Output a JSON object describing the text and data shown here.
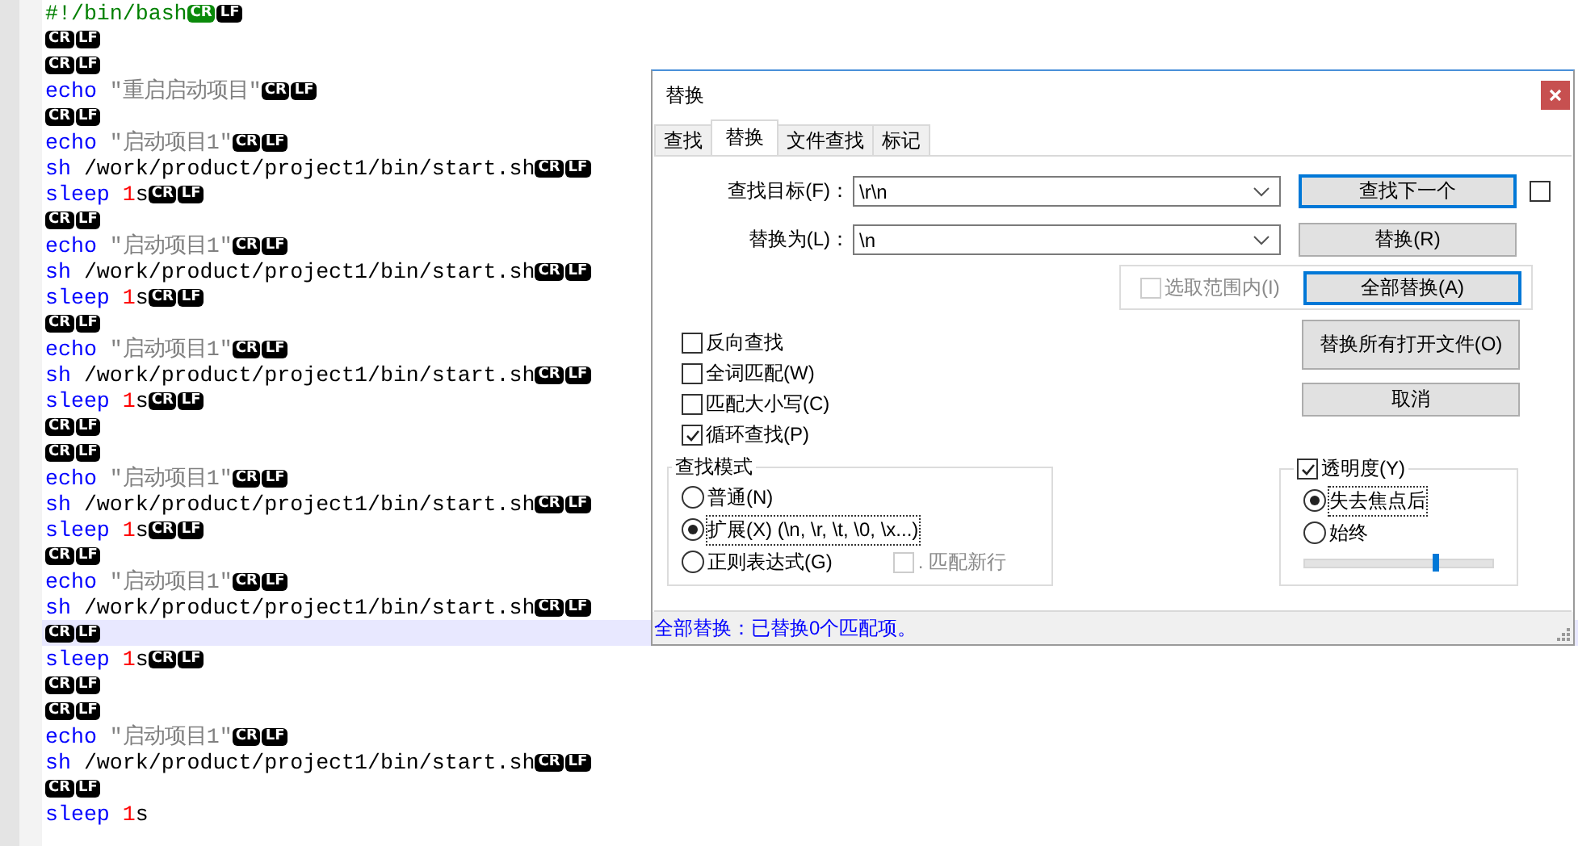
{
  "editor": {
    "lines": [
      {
        "tokens": [
          {
            "kind": "comment",
            "text": "#!/bin/bash"
          }
        ],
        "eol": [
          {
            "text": "CR",
            "highlighted": true
          },
          {
            "text": "LF",
            "highlighted": false
          }
        ],
        "current": false
      },
      {
        "eol": [
          {
            "text": "CR",
            "highlighted": false
          },
          {
            "text": "LF",
            "highlighted": false
          }
        ],
        "current": false
      },
      {
        "eol": [
          {
            "text": "CR",
            "highlighted": false
          },
          {
            "text": "LF",
            "highlighted": false
          }
        ],
        "current": false
      },
      {
        "tokens": [
          {
            "kind": "keyword",
            "text": "echo"
          },
          {
            "kind": "string",
            "text": " \"重启启动项目\""
          }
        ],
        "eol": [
          {
            "text": "CR",
            "highlighted": false
          },
          {
            "text": "LF",
            "highlighted": false
          }
        ],
        "current": false
      },
      {
        "eol": [
          {
            "text": "CR",
            "highlighted": false
          },
          {
            "text": "LF",
            "highlighted": false
          }
        ],
        "current": false
      },
      {
        "tokens": [
          {
            "kind": "keyword",
            "text": "echo"
          },
          {
            "kind": "string",
            "text": " \"启动项目1\""
          }
        ],
        "eol": [
          {
            "text": "CR",
            "highlighted": false
          },
          {
            "text": "LF",
            "highlighted": false
          }
        ],
        "current": false
      },
      {
        "tokens": [
          {
            "kind": "keyword",
            "text": "sh"
          },
          {
            "kind": "plain",
            "text": " /work/product/project1/bin/start.sh"
          }
        ],
        "eol": [
          {
            "text": "CR",
            "highlighted": false
          },
          {
            "text": "LF",
            "highlighted": false
          }
        ],
        "current": false
      },
      {
        "tokens": [
          {
            "kind": "keyword",
            "text": "sleep"
          },
          {
            "kind": "number",
            "text": " 1"
          },
          {
            "kind": "plain",
            "text": "s"
          }
        ],
        "eol": [
          {
            "text": "CR",
            "highlighted": false
          },
          {
            "text": "LF",
            "highlighted": false
          }
        ],
        "current": false
      },
      {
        "eol": [
          {
            "text": "CR",
            "highlighted": false
          },
          {
            "text": "LF",
            "highlighted": false
          }
        ],
        "current": false
      },
      {
        "tokens": [
          {
            "kind": "keyword",
            "text": "echo"
          },
          {
            "kind": "string",
            "text": " \"启动项目1\""
          }
        ],
        "eol": [
          {
            "text": "CR",
            "highlighted": false
          },
          {
            "text": "LF",
            "highlighted": false
          }
        ],
        "current": false
      },
      {
        "tokens": [
          {
            "kind": "keyword",
            "text": "sh"
          },
          {
            "kind": "plain",
            "text": " /work/product/project1/bin/start.sh"
          }
        ],
        "eol": [
          {
            "text": "CR",
            "highlighted": false
          },
          {
            "text": "LF",
            "highlighted": false
          }
        ],
        "current": false
      },
      {
        "tokens": [
          {
            "kind": "keyword",
            "text": "sleep"
          },
          {
            "kind": "number",
            "text": " 1"
          },
          {
            "kind": "plain",
            "text": "s"
          }
        ],
        "eol": [
          {
            "text": "CR",
            "highlighted": false
          },
          {
            "text": "LF",
            "highlighted": false
          }
        ],
        "current": false
      },
      {
        "eol": [
          {
            "text": "CR",
            "highlighted": false
          },
          {
            "text": "LF",
            "highlighted": false
          }
        ],
        "current": false
      },
      {
        "tokens": [
          {
            "kind": "keyword",
            "text": "echo"
          },
          {
            "kind": "string",
            "text": " \"启动项目1\""
          }
        ],
        "eol": [
          {
            "text": "CR",
            "highlighted": false
          },
          {
            "text": "LF",
            "highlighted": false
          }
        ],
        "current": false
      },
      {
        "tokens": [
          {
            "kind": "keyword",
            "text": "sh"
          },
          {
            "kind": "plain",
            "text": " /work/product/project1/bin/start.sh"
          }
        ],
        "eol": [
          {
            "text": "CR",
            "highlighted": false
          },
          {
            "text": "LF",
            "highlighted": false
          }
        ],
        "current": false
      },
      {
        "tokens": [
          {
            "kind": "keyword",
            "text": "sleep"
          },
          {
            "kind": "number",
            "text": " 1"
          },
          {
            "kind": "plain",
            "text": "s"
          }
        ],
        "eol": [
          {
            "text": "CR",
            "highlighted": false
          },
          {
            "text": "LF",
            "highlighted": false
          }
        ],
        "current": false
      },
      {
        "eol": [
          {
            "text": "CR",
            "highlighted": false
          },
          {
            "text": "LF",
            "highlighted": false
          }
        ],
        "current": false
      },
      {
        "eol": [
          {
            "text": "CR",
            "highlighted": false
          },
          {
            "text": "LF",
            "highlighted": false
          }
        ],
        "current": false
      },
      {
        "tokens": [
          {
            "kind": "keyword",
            "text": "echo"
          },
          {
            "kind": "string",
            "text": " \"启动项目1\""
          }
        ],
        "eol": [
          {
            "text": "CR",
            "highlighted": false
          },
          {
            "text": "LF",
            "highlighted": false
          }
        ],
        "current": false
      },
      {
        "tokens": [
          {
            "kind": "keyword",
            "text": "sh"
          },
          {
            "kind": "plain",
            "text": " /work/product/project1/bin/start.sh"
          }
        ],
        "eol": [
          {
            "text": "CR",
            "highlighted": false
          },
          {
            "text": "LF",
            "highlighted": false
          }
        ],
        "current": false
      },
      {
        "tokens": [
          {
            "kind": "keyword",
            "text": "sleep"
          },
          {
            "kind": "number",
            "text": " 1"
          },
          {
            "kind": "plain",
            "text": "s"
          }
        ],
        "eol": [
          {
            "text": "CR",
            "highlighted": false
          },
          {
            "text": "LF",
            "highlighted": false
          }
        ],
        "current": false
      },
      {
        "eol": [
          {
            "text": "CR",
            "highlighted": false
          },
          {
            "text": "LF",
            "highlighted": false
          }
        ],
        "current": false
      },
      {
        "tokens": [
          {
            "kind": "keyword",
            "text": "echo"
          },
          {
            "kind": "string",
            "text": " \"启动项目1\""
          }
        ],
        "eol": [
          {
            "text": "CR",
            "highlighted": false
          },
          {
            "text": "LF",
            "highlighted": false
          }
        ],
        "current": false
      },
      {
        "tokens": [
          {
            "kind": "keyword",
            "text": "sh"
          },
          {
            "kind": "plain",
            "text": " /work/product/project1/bin/start.sh"
          }
        ],
        "eol": [
          {
            "text": "CR",
            "highlighted": false
          },
          {
            "text": "LF",
            "highlighted": false
          }
        ],
        "current": false
      },
      {
        "eol": [
          {
            "text": "CR",
            "highlighted": false
          },
          {
            "text": "LF",
            "highlighted": false
          }
        ],
        "current": true
      },
      {
        "tokens": [
          {
            "kind": "keyword",
            "text": "sleep"
          },
          {
            "kind": "number",
            "text": " 1"
          },
          {
            "kind": "plain",
            "text": "s"
          }
        ],
        "eol": [
          {
            "text": "CR",
            "highlighted": false
          },
          {
            "text": "LF",
            "highlighted": false
          }
        ],
        "current": false
      },
      {
        "eol": [
          {
            "text": "CR",
            "highlighted": false
          },
          {
            "text": "LF",
            "highlighted": false
          }
        ],
        "current": false
      },
      {
        "eol": [
          {
            "text": "CR",
            "highlighted": false
          },
          {
            "text": "LF",
            "highlighted": false
          }
        ],
        "current": false
      },
      {
        "tokens": [
          {
            "kind": "keyword",
            "text": "echo"
          },
          {
            "kind": "string",
            "text": " \"启动项目1\""
          }
        ],
        "eol": [
          {
            "text": "CR",
            "highlighted": false
          },
          {
            "text": "LF",
            "highlighted": false
          }
        ],
        "current": false
      },
      {
        "tokens": [
          {
            "kind": "keyword",
            "text": "sh"
          },
          {
            "kind": "plain",
            "text": " /work/product/project1/bin/start.sh"
          }
        ],
        "eol": [
          {
            "text": "CR",
            "highlighted": false
          },
          {
            "text": "LF",
            "highlighted": false
          }
        ],
        "current": false
      },
      {
        "eol": [
          {
            "text": "CR",
            "highlighted": false
          },
          {
            "text": "LF",
            "highlighted": false
          }
        ],
        "current": false
      },
      {
        "tokens": [
          {
            "kind": "keyword",
            "text": "sleep"
          },
          {
            "kind": "number",
            "text": " 1"
          },
          {
            "kind": "plain",
            "text": "s"
          }
        ],
        "current": false
      }
    ]
  },
  "dialog": {
    "title": "替换",
    "tabs": [
      {
        "label": "查找",
        "selected": false
      },
      {
        "label": "替换",
        "selected": true
      },
      {
        "label": "文件查找",
        "selected": false
      },
      {
        "label": "标记",
        "selected": false
      }
    ],
    "fields": [
      {
        "label": "查找目标(F)：",
        "value": "\\r\\n"
      },
      {
        "label": "替换为(L)：",
        "value": "\\n"
      }
    ],
    "buttons": [
      {
        "label": "查找下一个",
        "focused": true
      },
      {
        "label": "替换(R)",
        "focused": false
      },
      {
        "label": "全部替换(A)",
        "focused": true
      },
      {
        "label": "替换所有打开文件(O)",
        "focused": false
      },
      {
        "label": "取消",
        "focused": false
      }
    ],
    "side_checkbox": {
      "checked": false
    },
    "in_selection": {
      "label": "选取范围内(I)",
      "checked": false,
      "disabled": true
    },
    "options": [
      {
        "label": "反向查找",
        "checked": false
      },
      {
        "label": "全词匹配(W)",
        "checked": false
      },
      {
        "label": "匹配大小写(C)",
        "checked": false
      },
      {
        "label": "循环查找(P)",
        "checked": true
      }
    ],
    "search_mode": {
      "title": "查找模式",
      "modes": [
        {
          "label": "普通(N)",
          "selected": false
        },
        {
          "label": "扩展(X) (\\n, \\r, \\t, \\0, \\x...)",
          "selected": true
        },
        {
          "label": "正则表达式(G)",
          "selected": false
        }
      ],
      "dot_newline": {
        "label": ". 匹配新行",
        "checked": false,
        "disabled": true
      }
    },
    "transparency": {
      "label": "透明度(Y)",
      "checked": true,
      "modes": [
        {
          "label": "失去焦点后",
          "selected": true
        },
        {
          "label": "始终",
          "selected": false
        }
      ],
      "level": 0.7
    },
    "status": "全部替换：已替换0个匹配项。"
  }
}
